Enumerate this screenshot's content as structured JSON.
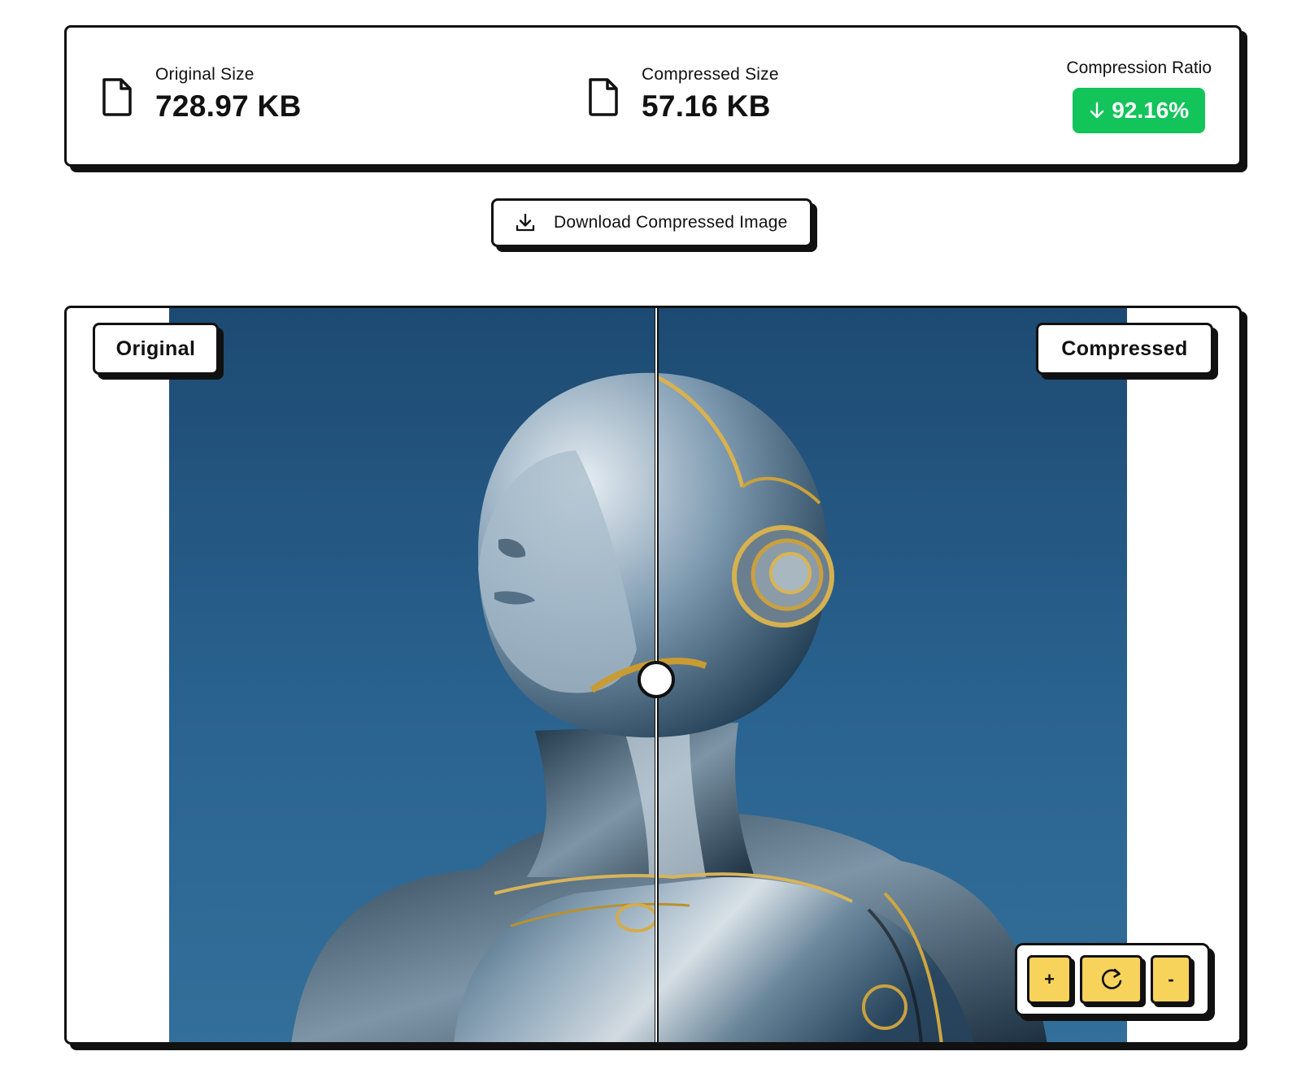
{
  "stats": {
    "original": {
      "label": "Original Size",
      "value": "728.97 KB",
      "icon": "file-icon"
    },
    "compressed": {
      "label": "Compressed Size",
      "value": "57.16 KB",
      "icon": "file-icon"
    },
    "ratio": {
      "label": "Compression Ratio",
      "value": "92.16%",
      "icon": "arrow-down-icon",
      "color": "#12c45a"
    }
  },
  "download": {
    "label": "Download Compressed Image",
    "icon": "download-icon"
  },
  "viewer": {
    "left_label": "Original",
    "right_label": "Compressed",
    "divider_position": 0.5,
    "controls": {
      "zoom_in_label": "+",
      "reset_icon": "rotate-cw-icon",
      "zoom_out_label": "-",
      "button_color": "#f7d35c"
    }
  }
}
